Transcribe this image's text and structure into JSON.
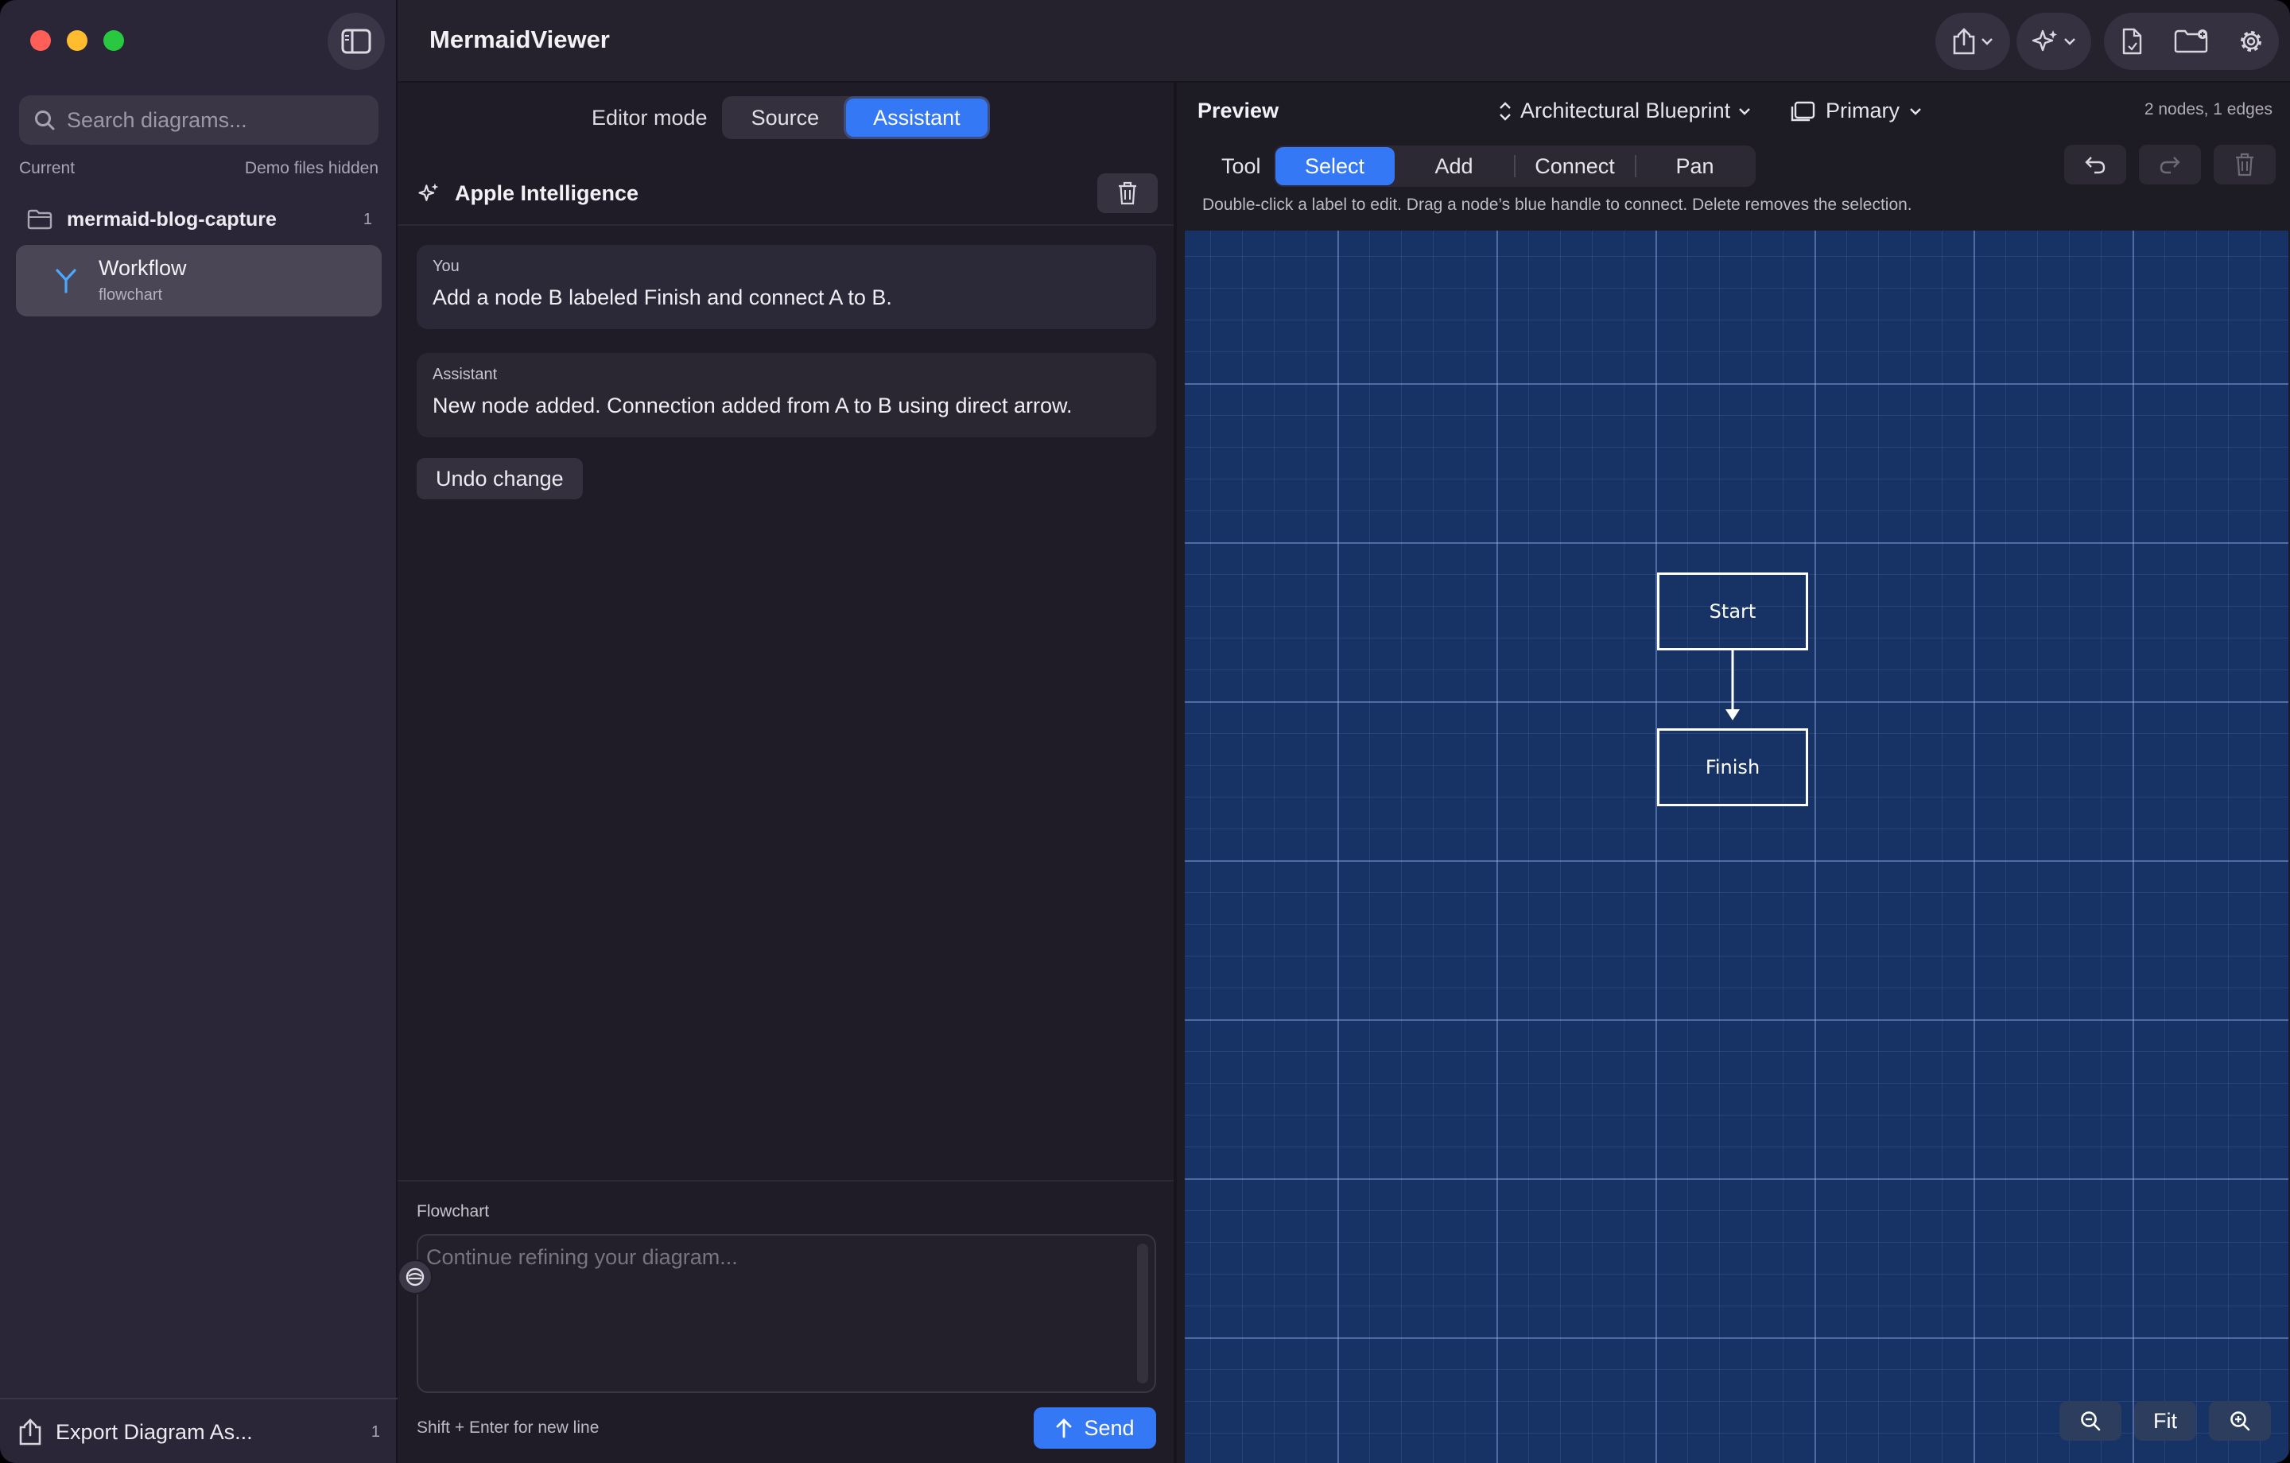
{
  "app": {
    "title": "MermaidViewer"
  },
  "sidebar": {
    "search_placeholder": "Search diagrams...",
    "section_label": "Current",
    "section_note": "Demo files hidden",
    "folder": {
      "name": "mermaid-blog-capture",
      "count": "1"
    },
    "file": {
      "name": "Workflow",
      "type": "flowchart"
    },
    "export": {
      "label": "Export Diagram As...",
      "count": "1"
    }
  },
  "editor": {
    "mode_label": "Editor mode",
    "modes": [
      "Source",
      "Assistant"
    ],
    "active_mode": "Assistant",
    "assistant_title": "Apple Intelligence",
    "messages": [
      {
        "role": "You",
        "text": "Add a node B labeled Finish and connect A to B."
      },
      {
        "role": "Assistant",
        "text": "New node added. Connection added from A to B using direct arrow."
      }
    ],
    "undo_label": "Undo change",
    "composer_label": "Flowchart",
    "composer_placeholder": "Continue refining your diagram...",
    "hint": "Shift + Enter for new line",
    "send_label": "Send"
  },
  "preview": {
    "title": "Preview",
    "theme": "Architectural Blueprint",
    "layer": "Primary",
    "stats": "2 nodes, 1 edges",
    "tool_label": "Tool",
    "tools": [
      "Select",
      "Add",
      "Connect",
      "Pan"
    ],
    "active_tool": "Select",
    "hint": "Double-click a label to edit. Drag a node’s blue handle to connect. Delete removes the selection.",
    "nodes": [
      {
        "id": "A",
        "label": "Start"
      },
      {
        "id": "B",
        "label": "Finish"
      }
    ],
    "fit_label": "Fit"
  },
  "colors": {
    "accent": "#3478f6",
    "canvas": "#173264",
    "sidebar": "#2a2637"
  },
  "icons": {
    "toolbar": [
      "share-icon",
      "sparkles-icon",
      "new-document-icon",
      "new-folder-icon",
      "gear-icon"
    ]
  }
}
